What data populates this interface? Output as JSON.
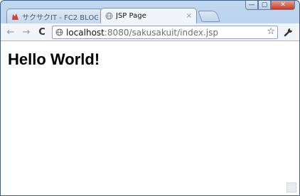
{
  "window": {
    "controls": {
      "minimize": "—",
      "maximize": "▢",
      "close": "✕"
    }
  },
  "tabs": [
    {
      "title": "サクサクIT - FC2 BLOG ( ",
      "active": false,
      "icon": "fc2-favicon"
    },
    {
      "title": "JSP Page",
      "active": true,
      "icon": "globe-icon",
      "close": "×"
    }
  ],
  "toolbar": {
    "back": "←",
    "forward": "→",
    "reload": "C",
    "url_host": "localhost",
    "url_path": ":8080/sakusakuit/index.jsp",
    "star": "☆"
  },
  "page": {
    "heading": "Hello World!"
  }
}
